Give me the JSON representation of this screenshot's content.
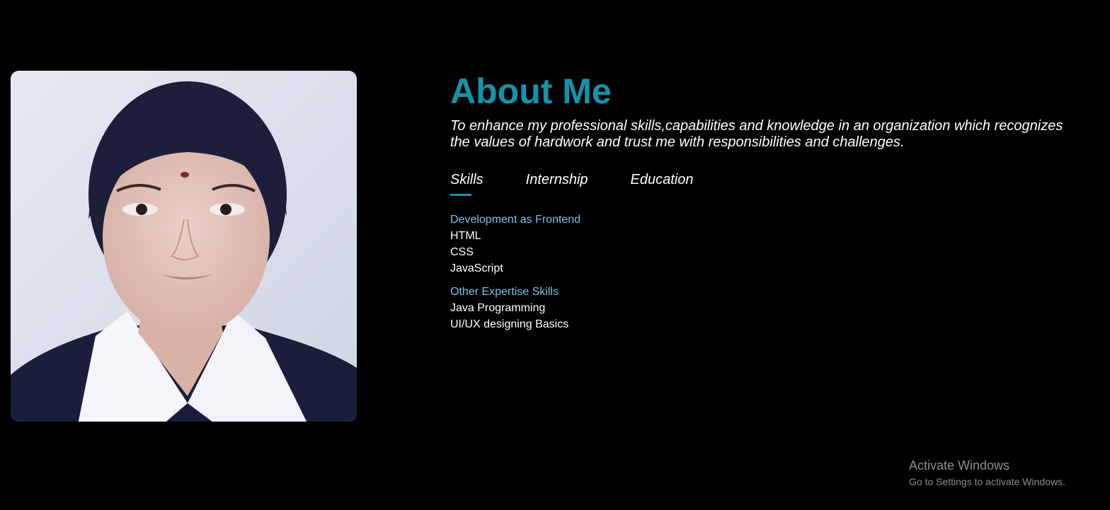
{
  "about": {
    "title": "About Me",
    "tagline": "To enhance my professional skills,capabilities and knowledge in an organization which recognizes the values of hardwork and trust me with responsibilities and challenges."
  },
  "tabs": [
    {
      "label": "Skills",
      "active": true
    },
    {
      "label": "Internship",
      "active": false
    },
    {
      "label": "Education",
      "active": false
    }
  ],
  "skills": {
    "groups": [
      {
        "heading": "Development as Frontend",
        "items": [
          "HTML",
          "CSS",
          "JavaScript"
        ]
      },
      {
        "heading": "Other Expertise Skills",
        "items": [
          "Java Programming",
          "UI/UX designing Basics"
        ]
      }
    ]
  },
  "watermark": {
    "title": "Activate Windows",
    "subtitle": "Go to Settings to activate Windows."
  },
  "colors": {
    "background": "#000000",
    "accent": "#1593ab",
    "group_heading": "#79c2e6",
    "text": "#ffffff"
  }
}
